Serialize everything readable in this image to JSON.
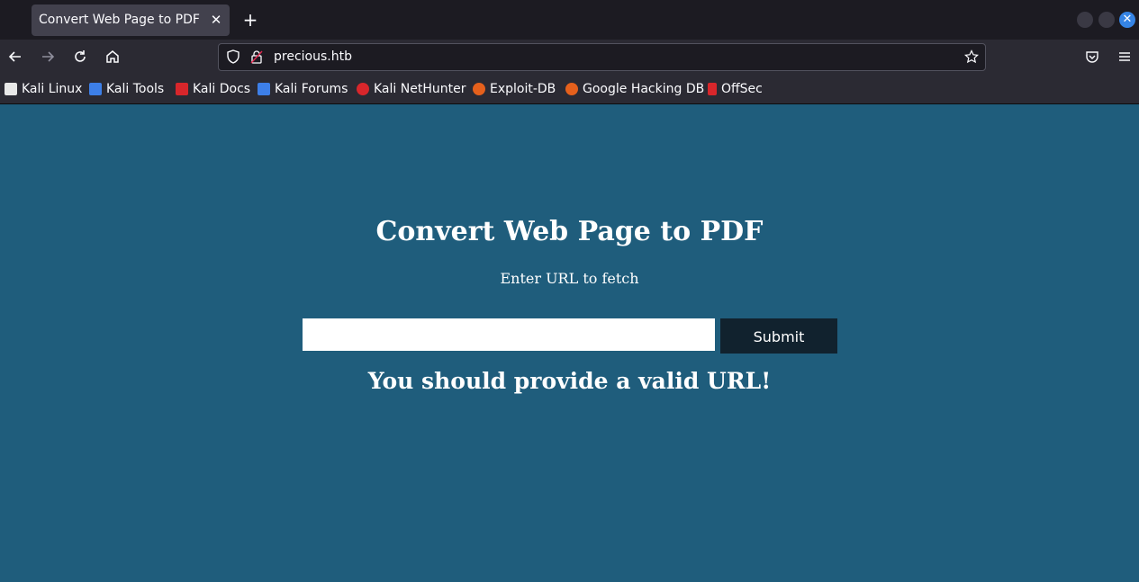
{
  "browser": {
    "tab": {
      "title": "Convert Web Page to PDF",
      "close_glyph": "✕"
    },
    "new_tab_glyph": "+",
    "url": "precious.htb",
    "bookmarks": [
      {
        "label": "Kali Linux",
        "icon": "kali-dragon-icon",
        "color": "#e8e8e8"
      },
      {
        "label": "Kali Tools",
        "icon": "kali-tools-icon",
        "color": "#3d7fe8"
      },
      {
        "label": "Kali Docs",
        "icon": "kali-docs-icon",
        "color": "#d8262b"
      },
      {
        "label": "Kali Forums",
        "icon": "kali-forums-icon",
        "color": "#3d7fe8"
      },
      {
        "label": "Kali NetHunter",
        "icon": "kali-nethunter-icon",
        "color": "#d8262b"
      },
      {
        "label": "Exploit-DB",
        "icon": "exploit-db-icon",
        "color": "#e5601c"
      },
      {
        "label": "Google Hacking DB",
        "icon": "ghdb-icon",
        "color": "#e5601c"
      },
      {
        "label": "OffSec",
        "icon": "offsec-icon",
        "color": "#d8262b"
      }
    ]
  },
  "page": {
    "title": "Convert Web Page to PDF",
    "subtitle": "Enter URL to fetch",
    "url_input_value": "",
    "submit_label": "Submit",
    "error": "You should provide a valid URL!"
  },
  "colors": {
    "page_background": "#1f5d7c",
    "submit_button": "#11222e",
    "accent": "#3584e4"
  }
}
